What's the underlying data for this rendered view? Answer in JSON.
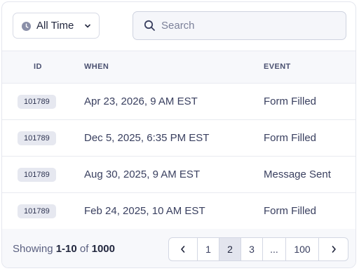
{
  "filter": {
    "time_label": "All Time",
    "icons": {
      "clock": "clock-icon",
      "chevron": "chevron-down-icon"
    }
  },
  "search": {
    "placeholder": "Search",
    "value": ""
  },
  "table": {
    "columns": [
      "ID",
      "WHEN",
      "EVENT"
    ],
    "rows": [
      {
        "id": "101789",
        "when": "Apr 23, 2026, 9 AM EST",
        "event": "Form Filled"
      },
      {
        "id": "101789",
        "when": "Dec 5, 2025, 6:35 PM EST",
        "event": "Form Filled"
      },
      {
        "id": "101789",
        "when": "Aug 30, 2025, 9 AM EST",
        "event": "Message Sent"
      },
      {
        "id": "101789",
        "when": "Feb 24, 2025, 10 AM EST",
        "event": "Form Filled"
      }
    ]
  },
  "footer": {
    "showing_prefix": "Showing",
    "range": "1-10",
    "of_label": "of",
    "total": "1000"
  },
  "pagination": {
    "pages": [
      "1",
      "2",
      "3",
      "...",
      "100"
    ],
    "active_page": "2"
  },
  "colors": {
    "accent": "#23283f",
    "header_bg": "#f7f8fb",
    "badge_bg": "#e6e8f0"
  }
}
